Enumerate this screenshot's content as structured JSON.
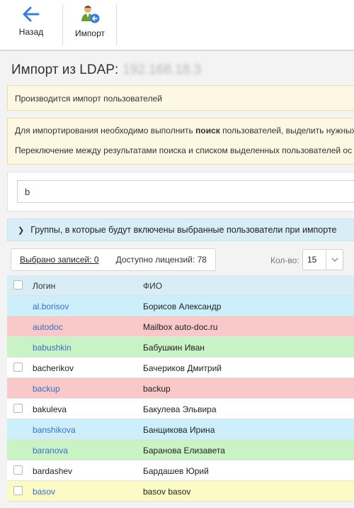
{
  "toolbar": {
    "back_label": "Назад",
    "import_label": "Импорт"
  },
  "page": {
    "title": "Импорт из LDAP:",
    "server": "192.168.18.3"
  },
  "alerts": {
    "status": "Производится импорт пользователей",
    "info_line1_pre": "Для импортирования необходимо выполнить ",
    "info_line1_bold": "поиск",
    "info_line1_post": " пользователей, выделить нужных",
    "info_line2": "Переключение между результатами поиска и списком выделенных пользователей ос"
  },
  "search": {
    "value": "b"
  },
  "groups_panel": {
    "label": "Группы, в которые будут включены выбранные пользователи при импорте"
  },
  "selection": {
    "selected_label": "Выбрано записей: 0",
    "licenses_label": "Доступно лицензий: 78"
  },
  "pager": {
    "count_label": "Кол-во:",
    "count_value": "15"
  },
  "table": {
    "headers": {
      "login": "Логин",
      "fio": "ФИО"
    },
    "rows": [
      {
        "login": "al.borisov",
        "fio": "Борисов Александр",
        "status": "blue",
        "checkbox": false
      },
      {
        "login": "autodoc",
        "fio": "Mailbox auto-doc.ru",
        "status": "red",
        "checkbox": false
      },
      {
        "login": "babushkin",
        "fio": "Бабушкин Иван",
        "status": "green",
        "checkbox": false
      },
      {
        "login": "bacherikov",
        "fio": "Бачериков Дмитрий",
        "status": "white",
        "checkbox": true
      },
      {
        "login": "backup",
        "fio": "backup",
        "status": "red",
        "checkbox": false
      },
      {
        "login": "bakuleva",
        "fio": "Бакулева Эльвира",
        "status": "white",
        "checkbox": true
      },
      {
        "login": "banshikova",
        "fio": "Банщикова Ирина",
        "status": "blue",
        "checkbox": false
      },
      {
        "login": "baranova",
        "fio": "Баранова Елизавета",
        "status": "green",
        "checkbox": false
      },
      {
        "login": "bardashev",
        "fio": "Бардашев Юрий",
        "status": "white",
        "checkbox": true
      },
      {
        "login": "basov",
        "fio": "basov basov",
        "status": "yellow",
        "checkbox": true
      }
    ]
  },
  "colors": {
    "accent": "#3a7fd5",
    "row_blue": "#cdeffc",
    "row_red": "#f9c9c9",
    "row_green": "#c9f3c4",
    "row_yellow": "#fdfbc5",
    "header_blue": "#d9edf7",
    "alert_yellow": "#fcf8e3"
  },
  "icons": {
    "back": "arrow-left-icon",
    "import": "user-import-icon",
    "groups": "chevron-right-icon",
    "count": "chevron-down-icon"
  }
}
